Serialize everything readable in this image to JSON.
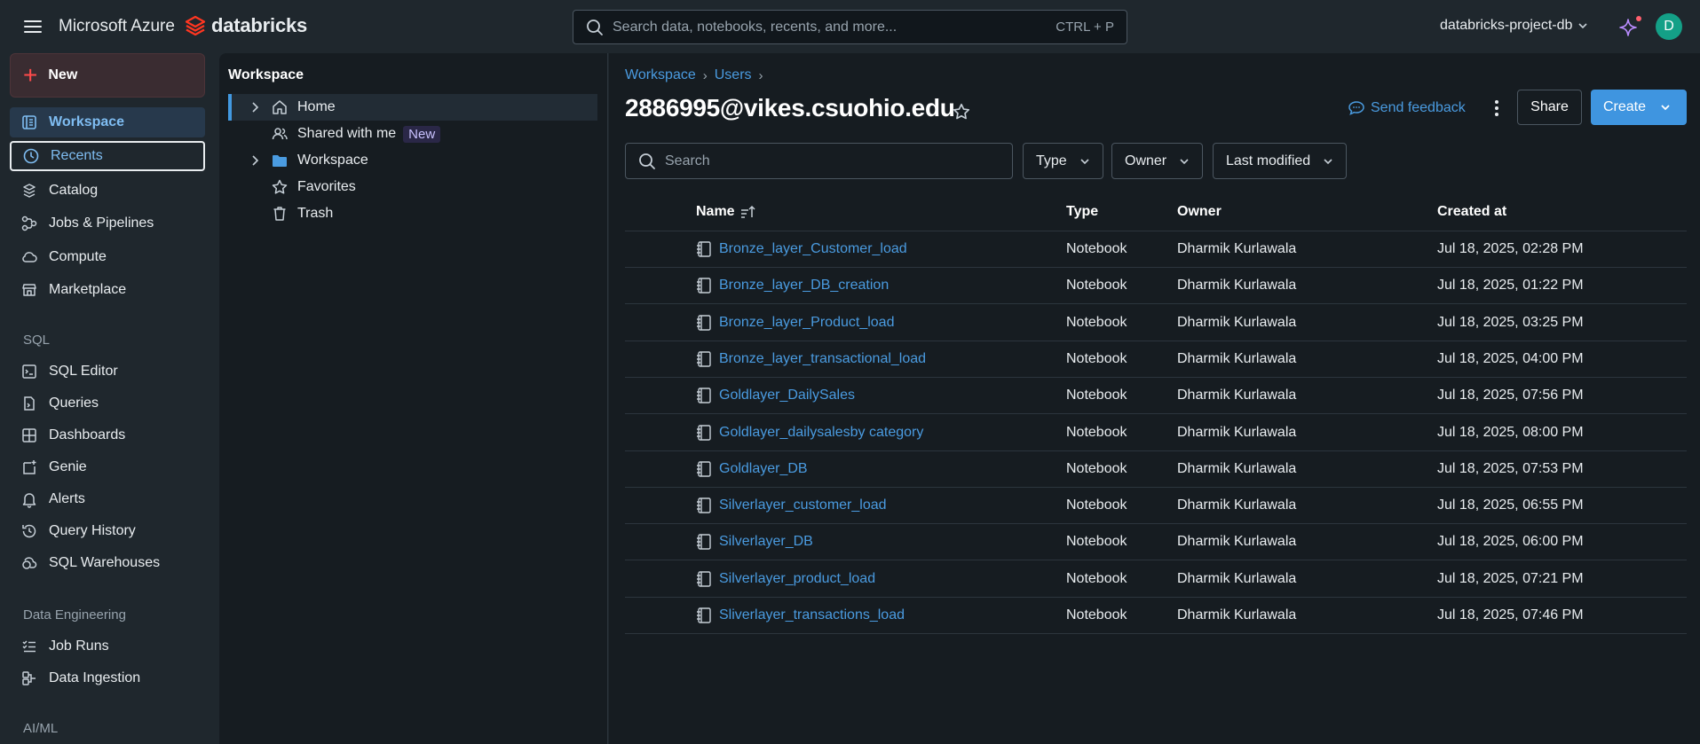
{
  "topbar": {
    "menu_icon": "hamburger-icon",
    "brand_microsoft": "Microsoft Azure",
    "brand_databricks": "databricks",
    "search_placeholder": "Search data, notebooks, recents, and more...",
    "search_shortcut": "CTRL + P",
    "workspace_name": "databricks-project-db",
    "avatar_initial": "D"
  },
  "sidebar": {
    "new_label": "New",
    "items": [
      {
        "label": "Workspace",
        "icon": "workspace-icon"
      },
      {
        "label": "Recents",
        "icon": "clock-icon"
      },
      {
        "label": "Catalog",
        "icon": "catalog-icon"
      },
      {
        "label": "Jobs & Pipelines",
        "icon": "pipelines-icon"
      },
      {
        "label": "Compute",
        "icon": "cloud-icon"
      },
      {
        "label": "Marketplace",
        "icon": "store-icon"
      }
    ],
    "section_sql": "SQL",
    "sql_items": [
      {
        "label": "SQL Editor",
        "icon": "sql-editor-icon"
      },
      {
        "label": "Queries",
        "icon": "queries-icon"
      },
      {
        "label": "Dashboards",
        "icon": "dashboard-icon"
      },
      {
        "label": "Genie",
        "icon": "genie-icon"
      },
      {
        "label": "Alerts",
        "icon": "bell-icon"
      },
      {
        "label": "Query History",
        "icon": "history-icon"
      },
      {
        "label": "SQL Warehouses",
        "icon": "warehouse-icon"
      }
    ],
    "section_data_eng": "Data Engineering",
    "de_items": [
      {
        "label": "Job Runs",
        "icon": "job-runs-icon"
      },
      {
        "label": "Data Ingestion",
        "icon": "ingestion-icon"
      }
    ],
    "section_aiml": "AI/ML"
  },
  "tree": {
    "title": "Workspace",
    "items": [
      {
        "label": "Home",
        "icon": "home-icon"
      },
      {
        "label": "Shared with me",
        "icon": "users-icon",
        "badge": "New"
      },
      {
        "label": "Workspace",
        "icon": "folder-icon"
      },
      {
        "label": "Favorites",
        "icon": "star-icon"
      },
      {
        "label": "Trash",
        "icon": "trash-icon"
      }
    ]
  },
  "main": {
    "breadcrumb": [
      "Workspace",
      "Users"
    ],
    "title": "2886995@vikes.csuohio.edu",
    "send_feedback": "Send feedback",
    "share": "Share",
    "create": "Create",
    "search_placeholder": "Search",
    "filters": [
      "Type",
      "Owner",
      "Last modified"
    ],
    "columns": [
      "Name",
      "Type",
      "Owner",
      "Created at"
    ],
    "rows": [
      {
        "name": "Bronze_layer_Customer_load",
        "type": "Notebook",
        "owner": "Dharmik Kurlawala",
        "created": "Jul 18, 2025, 02:28 PM"
      },
      {
        "name": "Bronze_layer_DB_creation",
        "type": "Notebook",
        "owner": "Dharmik Kurlawala",
        "created": "Jul 18, 2025, 01:22 PM"
      },
      {
        "name": "Bronze_layer_Product_load",
        "type": "Notebook",
        "owner": "Dharmik Kurlawala",
        "created": "Jul 18, 2025, 03:25 PM"
      },
      {
        "name": "Bronze_layer_transactional_load",
        "type": "Notebook",
        "owner": "Dharmik Kurlawala",
        "created": "Jul 18, 2025, 04:00 PM"
      },
      {
        "name": "Goldlayer_DailySales",
        "type": "Notebook",
        "owner": "Dharmik Kurlawala",
        "created": "Jul 18, 2025, 07:56 PM"
      },
      {
        "name": "Goldlayer_dailysalesby category",
        "type": "Notebook",
        "owner": "Dharmik Kurlawala",
        "created": "Jul 18, 2025, 08:00 PM"
      },
      {
        "name": "Goldlayer_DB",
        "type": "Notebook",
        "owner": "Dharmik Kurlawala",
        "created": "Jul 18, 2025, 07:53 PM"
      },
      {
        "name": "Silverlayer_customer_load",
        "type": "Notebook",
        "owner": "Dharmik Kurlawala",
        "created": "Jul 18, 2025, 06:55 PM"
      },
      {
        "name": "Silverlayer_DB",
        "type": "Notebook",
        "owner": "Dharmik Kurlawala",
        "created": "Jul 18, 2025, 06:00 PM"
      },
      {
        "name": "Silverlayer_product_load",
        "type": "Notebook",
        "owner": "Dharmik Kurlawala",
        "created": "Jul 18, 2025, 07:21 PM"
      },
      {
        "name": "Sliverlayer_transactions_load",
        "type": "Notebook",
        "owner": "Dharmik Kurlawala",
        "created": "Jul 18, 2025, 07:46 PM"
      }
    ]
  },
  "colors": {
    "accent": "#3f95e0",
    "link": "#4a9be0",
    "new_plus": "#ff4a4a",
    "avatar": "#14a087",
    "background": "#161c21",
    "chrome": "#1f272d"
  }
}
